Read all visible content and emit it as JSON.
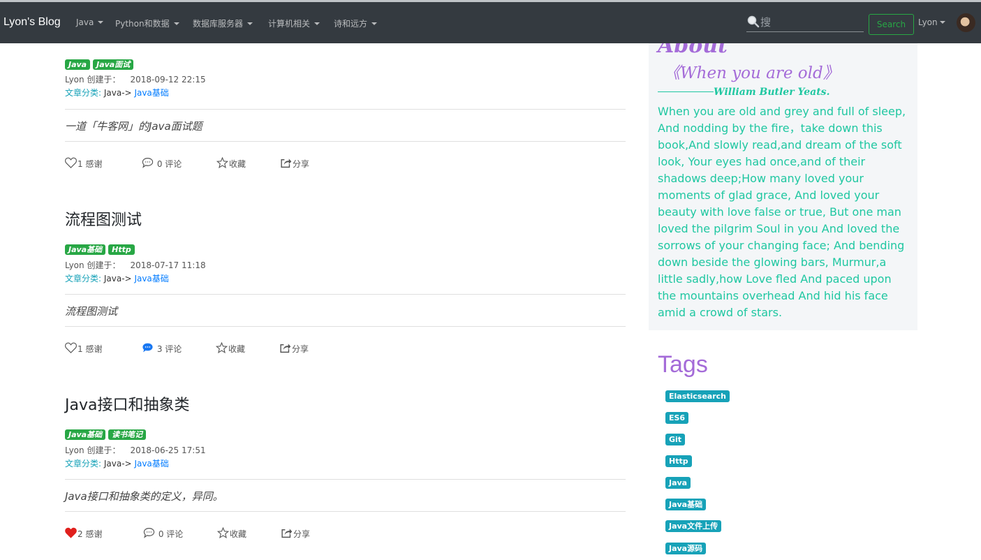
{
  "navbar": {
    "brand": "Lyon's Blog",
    "menus": [
      "Java",
      "Python和数据",
      "数据库服务器",
      "计算机相关",
      "诗和远方"
    ],
    "search_placeholder": "搜",
    "search_button": "Search",
    "user": "Lyon"
  },
  "posts": [
    {
      "title": "",
      "tags": [
        "Java",
        "Java面试"
      ],
      "author": "Lyon 创建于：",
      "date": "2018-09-12 22:15",
      "category_label": "文章分类:",
      "category_parent": "Java->",
      "category_child": "Java基础",
      "summary": "一道「牛客网」的Java面试题",
      "likes": "1 感谢",
      "comments": "0 评论",
      "favorite": "收藏",
      "share": "分享",
      "liked": false,
      "has_comments": false
    },
    {
      "title": "流程图测试",
      "tags": [
        "Java基础",
        "Http"
      ],
      "author": "Lyon 创建于：",
      "date": "2018-07-17 11:18",
      "category_label": "文章分类:",
      "category_parent": "Java->",
      "category_child": "Java基础",
      "summary": "流程图测试",
      "likes": "1 感谢",
      "comments": "3 评论",
      "favorite": "收藏",
      "share": "分享",
      "liked": false,
      "has_comments": true
    },
    {
      "title": "Java接口和抽象类",
      "tags": [
        "Java基础",
        "读书笔记"
      ],
      "author": "Lyon 创建于：",
      "date": "2018-06-25 17:51",
      "category_label": "文章分类:",
      "category_parent": "Java->",
      "category_child": "Java基础",
      "summary": "Java接口和抽象类的定义，异同。",
      "likes": "2 感谢",
      "comments": "0 评论",
      "favorite": "收藏",
      "share": "分享",
      "liked": true,
      "has_comments": false
    }
  ],
  "sidebar": {
    "about_title": "About",
    "poem_title": "《When you are old》",
    "poem_author": "William Butler Yeats.",
    "poem_text": "When you are old and grey and full of sleep, And nodding by the fire，take down this book,And slowly read,and dream of the soft look, Your eyes had once,and of their shadows deep;How many loved your moments of glad grace, And loved your beauty with love false or true, But one man loved the pilgrim Soul in you And loved the sorrows of your changing face; And bending down beside the glowing bars, Murmur,a little sadly,how Love fled And paced upon the mountains overhead And hid his face amid a crowd of stars.",
    "tags_title": "Tags",
    "tags": [
      "Elasticsearch",
      "ES6",
      "Git",
      "Http",
      "Java",
      "Java基础",
      "Java文件上传",
      "Java源码"
    ]
  },
  "colors": {
    "navbar_bg": "#343a40",
    "tag_green": "#28a745",
    "tag_teal": "#17a2b8",
    "poem_green": "#1fc7a1",
    "heading_purple": "#a46bd8",
    "link_blue": "#007bff",
    "heart_red": "#e0201d",
    "comment_blue": "#1877f2"
  }
}
